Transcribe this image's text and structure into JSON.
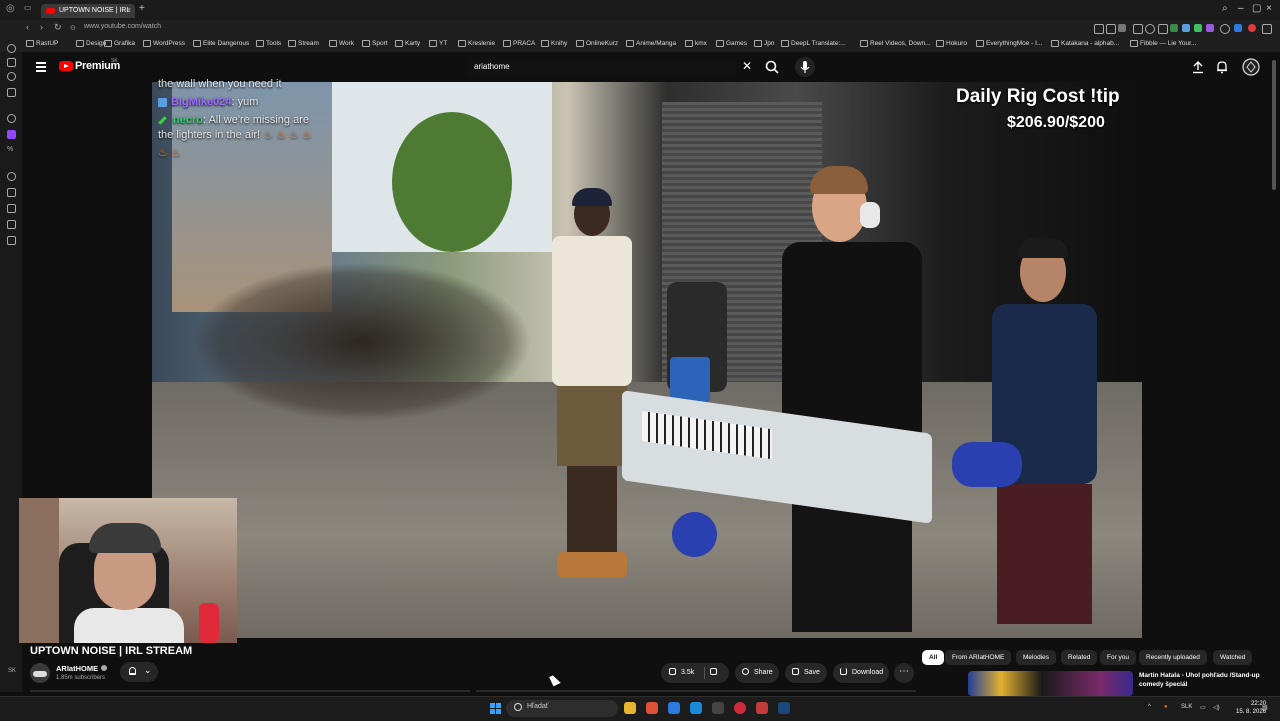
{
  "browser": {
    "tab_title": "UPTOWN NOISE | IRL",
    "url": "www.youtube.com/watch",
    "bookmarks": [
      "RastUP",
      "Design",
      "Grafika",
      "WordPress",
      "Elite Dangerous",
      "Tools",
      "Stream",
      "Work",
      "Sport",
      "Karty",
      "YT",
      "Kreslenie",
      "PRACA",
      "Knihy",
      "OnlineKurz",
      "Anime/Manga",
      "kmx",
      "Games",
      "Jpn",
      "DeepL Translate:...",
      "Reel Videos, Down...",
      "Hokuro",
      "EverythingMoe - I...",
      "Katakana - alphab...",
      "Fibble — Lie Your..."
    ]
  },
  "header": {
    "logo_text": "Premium",
    "region": "SK",
    "search_value": "ariathome"
  },
  "video": {
    "overlay_title": "Daily Rig Cost !tip",
    "overlay_value": "$206.90/$200",
    "chat": [
      {
        "text": "the wall when you need it"
      },
      {
        "user": "BigMike024",
        "text": ": yum"
      },
      {
        "user": "necro",
        "text": ": All we're missing are"
      },
      {
        "text": "the lighters in the air!"
      }
    ]
  },
  "info": {
    "title": "UPTOWN NOISE | IRL STREAM",
    "channel": "ARIatHOME",
    "subscribers": "1.85m subscribers",
    "likes": "3.5k",
    "share": "Share",
    "save": "Save",
    "download": "Download",
    "side_label": "SK"
  },
  "chips": [
    "All",
    "From ARIatHOME",
    "Melodies",
    "Related",
    "For you",
    "Recently uploaded",
    "Watched"
  ],
  "suggestion": {
    "title": "Martin Hatala - Uhol pohľadu /Stand-up comedy špeciál"
  },
  "taskbar": {
    "search_placeholder": "Hľadať",
    "lang": "SLK",
    "time": "22:20",
    "date": "15. 8. 2026"
  },
  "colors": {
    "youtube_red": "#ff0000",
    "background": "#0f0f0f",
    "chip_bg": "#272727"
  }
}
